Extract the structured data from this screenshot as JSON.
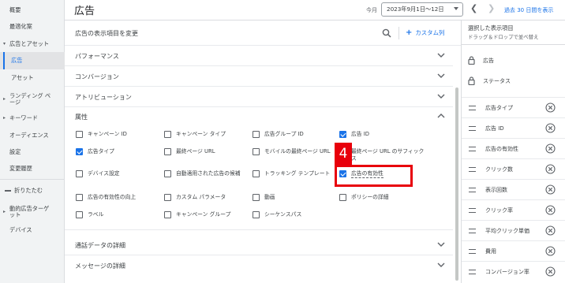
{
  "nav": {
    "items": [
      {
        "label": "概要"
      },
      {
        "label": "最適化案"
      },
      {
        "label": "広告とアセット"
      },
      {
        "label": "広告"
      },
      {
        "label": "アセット"
      },
      {
        "label": "ランディング ページ"
      },
      {
        "label": "キーワード"
      },
      {
        "label": "オーディエンス"
      },
      {
        "label": "設定"
      },
      {
        "label": "変更履歴"
      },
      {
        "label": "折りたたむ"
      },
      {
        "label": "動的広告ターゲット"
      },
      {
        "label": "デバイス"
      }
    ]
  },
  "header": {
    "title": "広告",
    "period_label": "今月",
    "date_range": "2023年9月1日～12日",
    "show_last": "過去 30 日間を表示"
  },
  "panel": {
    "title": "広告の表示項目を変更",
    "add_custom": "カスタム列",
    "sections": {
      "performance": "パフォーマンス",
      "conversion": "コンバージョン",
      "attribution": "アトリビューション",
      "attributes": "属性",
      "call_details": "通話データの詳細",
      "message_details": "メッセージの詳細"
    },
    "attributes": [
      {
        "label": "キャンペーン ID",
        "checked": false
      },
      {
        "label": "キャンペーン タイプ",
        "checked": false
      },
      {
        "label": "広告グループ ID",
        "checked": false
      },
      {
        "label": "広告 ID",
        "checked": true
      },
      {
        "label": "広告タイプ",
        "checked": true
      },
      {
        "label": "最終ページ URL",
        "checked": false
      },
      {
        "label": "モバイルの最終ページ URL",
        "checked": false
      },
      {
        "label": "最終ページ URL のサフィックス",
        "checked": false
      },
      {
        "label": "デバイス設定",
        "checked": false
      },
      {
        "label": "自動適用された広告の候補",
        "checked": false
      },
      {
        "label": "トラッキング テンプレート",
        "checked": false
      },
      {
        "label": "広告の有効性",
        "checked": true
      },
      {
        "label": "広告の有効性の向上",
        "checked": false
      },
      {
        "label": "カスタム パラメータ",
        "checked": false
      },
      {
        "label": "動画",
        "checked": false
      },
      {
        "label": "ポリシーの詳細",
        "checked": false
      },
      {
        "label": "ラベル",
        "checked": false
      },
      {
        "label": "キャンペーン グループ",
        "checked": false
      },
      {
        "label": "シーケンスパス",
        "checked": false
      }
    ],
    "annotation_step": "4"
  },
  "selected": {
    "title": "選択した表示項目",
    "subtitle": "ドラッグ＆ドロップで並べ替え",
    "locked": [
      "広告",
      "ステータス"
    ],
    "columns": [
      "広告タイプ",
      "広告 ID",
      "広告の有効性",
      "クリック数",
      "表示回数",
      "クリック率",
      "平均クリック単価",
      "費用",
      "コンバージョン率"
    ]
  },
  "colors": {
    "accent": "#1a73e8",
    "annotation": "#e8000b"
  }
}
